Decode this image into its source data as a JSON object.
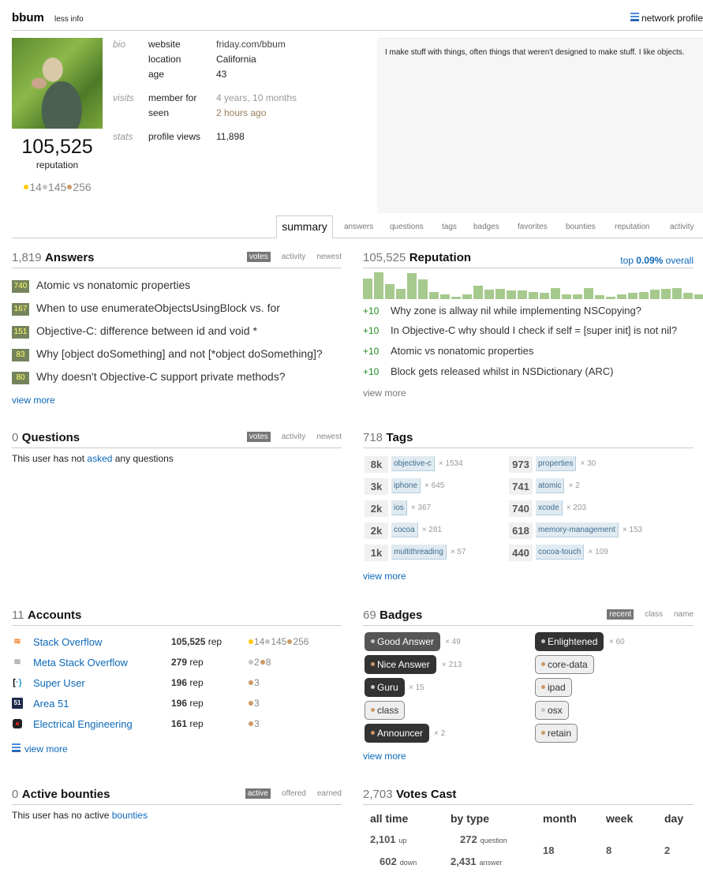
{
  "header": {
    "username": "bbum",
    "less_info": "less info",
    "network_profile": "network profile"
  },
  "profile": {
    "reputation": "105,525",
    "reputation_label": "reputation",
    "badges": {
      "gold": "14",
      "silver": "145",
      "bronze": "256"
    },
    "bio_section": "bio",
    "visits_section": "visits",
    "stats_section": "stats",
    "fields": [
      {
        "key": "website",
        "value": "friday.com/bbum"
      },
      {
        "key": "location",
        "value": "California"
      },
      {
        "key": "age",
        "value": "43"
      },
      {
        "key": "member for",
        "value": "4 years, 10 months"
      },
      {
        "key": "seen",
        "value": "2 hours ago"
      },
      {
        "key": "profile views",
        "value": "11,898"
      }
    ],
    "about": "I make stuff with things, often things that weren't designed to make stuff. I like objects."
  },
  "tabs": [
    "summary",
    "answers",
    "questions",
    "tags",
    "badges",
    "favorites",
    "bounties",
    "reputation",
    "activity"
  ],
  "answers": {
    "count": "1,819",
    "title": "Answers",
    "sorts": [
      "votes",
      "activity",
      "newest"
    ],
    "items": [
      {
        "score": "740",
        "title": "Atomic vs nonatomic properties"
      },
      {
        "score": "167",
        "title": "When to use enumerateObjectsUsingBlock vs. for"
      },
      {
        "score": "151",
        "title": "Objective-C: difference between id and void *"
      },
      {
        "score": "83",
        "title": "Why [object doSomething] and not [*object doSomething]?"
      },
      {
        "score": "80",
        "title": "Why doesn't Objective-C support private methods?"
      }
    ],
    "view_more": "view more"
  },
  "reputation_module": {
    "count": "105,525",
    "title": "Reputation",
    "top_prefix": "top ",
    "top_value": "0.09%",
    "top_suffix": " overall",
    "graph_values": [
      55,
      72,
      40,
      28,
      70,
      53,
      18,
      12,
      6,
      13,
      35,
      25,
      28,
      23,
      23,
      18,
      16,
      30,
      13,
      13,
      30,
      11,
      6,
      13,
      16,
      20,
      25,
      28,
      30,
      16,
      13
    ],
    "items": [
      {
        "delta": "+10",
        "title": "Why zone is allway nil while implementing NSCopying?"
      },
      {
        "delta": "+10",
        "title": "In Objective-C why should I check if self = [super init] is not nil?"
      },
      {
        "delta": "+10",
        "title": "Atomic vs nonatomic properties"
      },
      {
        "delta": "+10",
        "title": "Block gets released whilst in NSDictionary (ARC)"
      }
    ],
    "view_more": "view more"
  },
  "questions": {
    "count": "0",
    "title": "Questions",
    "sorts": [
      "votes",
      "activity",
      "newest"
    ],
    "empty_prefix": "This user has not ",
    "empty_link": "asked",
    "empty_suffix": " any questions"
  },
  "tags": {
    "count": "718",
    "title": "Tags",
    "items": [
      {
        "score": "8k",
        "name": "objective-c",
        "count": "× 1534"
      },
      {
        "score": "3k",
        "name": "iphone",
        "count": "× 645"
      },
      {
        "score": "2k",
        "name": "ios",
        "count": "× 367"
      },
      {
        "score": "2k",
        "name": "cocoa",
        "count": "× 281"
      },
      {
        "score": "1k",
        "name": "multithreading",
        "count": "× 57"
      },
      {
        "score": "973",
        "name": "properties",
        "count": "× 30"
      },
      {
        "score": "741",
        "name": "atomic",
        "count": "× 2"
      },
      {
        "score": "740",
        "name": "xcode",
        "count": "× 203"
      },
      {
        "score": "618",
        "name": "memory-management",
        "count": "× 153"
      },
      {
        "score": "440",
        "name": "cocoa-touch",
        "count": "× 109"
      }
    ],
    "view_more": "view more"
  },
  "accounts": {
    "count": "11",
    "title": "Accounts",
    "items": [
      {
        "icon": "stackoverflow-icon",
        "name": "Stack Overflow",
        "rep": "105,525",
        "rep_suffix": " rep",
        "gold": "14",
        "silver": "145",
        "bronze": "256"
      },
      {
        "icon": "meta-stackoverflow-icon",
        "name": "Meta Stack Overflow",
        "rep": "279",
        "rep_suffix": " rep",
        "silver": "2",
        "bronze": "8"
      },
      {
        "icon": "superuser-icon",
        "name": "Super User",
        "rep": "196",
        "rep_suffix": " rep",
        "bronze": "3"
      },
      {
        "icon": "area51-icon",
        "name": "Area 51",
        "rep": "196",
        "rep_suffix": " rep",
        "bronze": "3"
      },
      {
        "icon": "electrical-engineering-icon",
        "name": "Electrical Engineering",
        "rep": "161",
        "rep_suffix": " rep",
        "bronze": "3"
      }
    ],
    "view_more": "view more"
  },
  "badges_module": {
    "count": "69",
    "title": "Badges",
    "sorts": [
      "recent",
      "class",
      "name"
    ],
    "items": [
      {
        "name": "Good Answer",
        "class": "silver",
        "count": "× 49"
      },
      {
        "name": "Nice Answer",
        "class": "bronze",
        "count": "× 213"
      },
      {
        "name": "Guru",
        "class": "silver",
        "count": "× 15"
      },
      {
        "name": "class",
        "class": "bronze",
        "count": ""
      },
      {
        "name": "Announcer",
        "class": "bronze",
        "count": "× 2"
      },
      {
        "name": "Enlightened",
        "class": "silver",
        "count": "× 60"
      },
      {
        "name": "core-data",
        "class": "bronze",
        "count": ""
      },
      {
        "name": "ipad",
        "class": "bronze",
        "count": ""
      },
      {
        "name": "osx",
        "class": "silver",
        "count": ""
      },
      {
        "name": "retain",
        "class": "bronze",
        "count": ""
      }
    ],
    "view_more": "view more"
  },
  "bounties": {
    "count": "0",
    "title": "Active bounties",
    "sorts": [
      "active",
      "offered",
      "earned"
    ],
    "empty_prefix": "This user has no active ",
    "empty_link": "bounties"
  },
  "votes": {
    "count": "2,703",
    "title": "Votes Cast",
    "headers": [
      "all time",
      "by type",
      "month",
      "week",
      "day"
    ],
    "up": "2,101",
    "up_label": "up",
    "down": "602",
    "down_label": "down",
    "question": "272",
    "question_label": "question",
    "answer": "2,431",
    "answer_label": "answer",
    "month": "18",
    "week": "8",
    "day": "2"
  }
}
